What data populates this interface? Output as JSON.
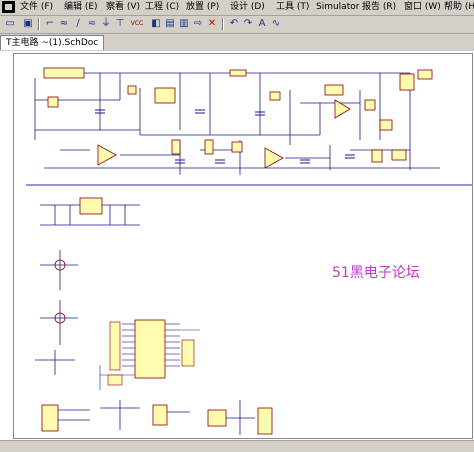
{
  "menus": [
    {
      "label": "文件 (F)"
    },
    {
      "label": "编辑 (E)"
    },
    {
      "label": "察看 (V)"
    },
    {
      "label": "工程 (C)"
    },
    {
      "label": "放置 (P)"
    },
    {
      "label": "设计 (D)"
    },
    {
      "label": "工具 (T)"
    },
    {
      "label": "Simulator"
    },
    {
      "label": "报告 (R)"
    },
    {
      "label": "窗口 (W)"
    },
    {
      "label": "帮助 (H)"
    }
  ],
  "toolbar": {
    "icons": [
      "open-icon",
      "save-icon",
      "wire-icon",
      "bus-icon",
      "bus-entry-icon",
      "net-label-icon",
      "ground-icon",
      "power-port-icon",
      "part-icon",
      "sheet-symbol-icon",
      "sheet-entry-icon",
      "port-icon",
      "no-erc-icon",
      "undo-icon",
      "redo-icon",
      "text-icon",
      "sim-icon"
    ],
    "vcc_label": "VCC"
  },
  "document": {
    "tab_label": "T主电路 ~(1).SchDoc"
  },
  "schematic": {
    "watermark": "51黑电子论坛",
    "colors": {
      "wire": "#1a1a8c",
      "component": "#8b0000",
      "sheet_border": "#8a8a8a",
      "divider": "#2b2bb0",
      "ic_fill": "#fffcb0",
      "watermark": "#c03ac8"
    }
  }
}
